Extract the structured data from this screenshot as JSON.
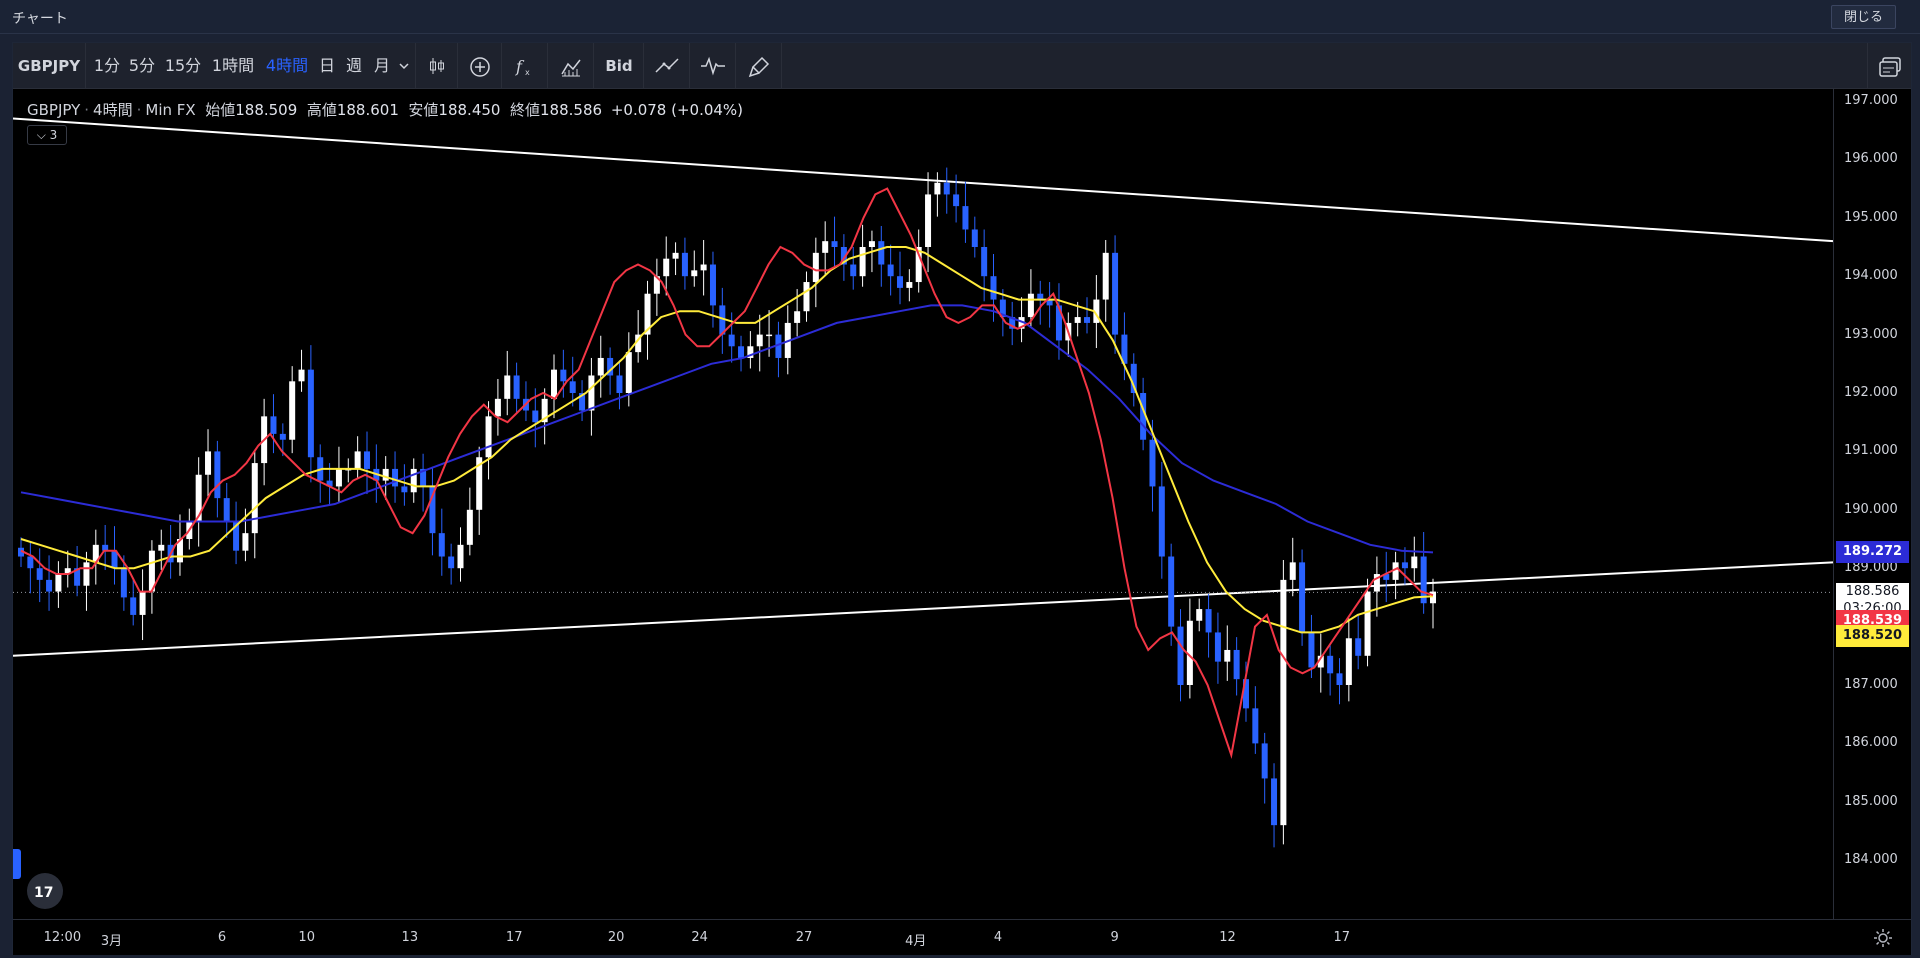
{
  "window": {
    "title": "チャート",
    "close_label": "閉じる"
  },
  "toolbar": {
    "symbol": "GBPJPY",
    "intervals": [
      "1分",
      "5分",
      "15分",
      "1時間",
      "4時間",
      "日",
      "週",
      "月"
    ],
    "active_interval": "4時間",
    "bid_label": "Bid",
    "icons": [
      "candle-style-icon",
      "add-compare-icon",
      "indicators-icon",
      "chart-type-icon",
      "line-tool-icon",
      "oscillator-icon",
      "brush-icon",
      "layout-icon"
    ]
  },
  "legend": {
    "symbol": "GBPJPY",
    "interval": "4時間",
    "source": "Min FX",
    "open_label": "始値",
    "open": "188.509",
    "high_label": "高値",
    "high": "188.601",
    "low_label": "安値",
    "low": "188.450",
    "close_label": "終値",
    "close": "188.586",
    "change": "+0.078 (+0.04%)",
    "collapsed_count": "3"
  },
  "price_axis": {
    "ticks": [
      "197.000",
      "196.000",
      "195.000",
      "194.000",
      "193.000",
      "192.000",
      "191.000",
      "190.000",
      "189.000",
      "188.000",
      "187.000",
      "186.000",
      "185.000",
      "184.000"
    ],
    "labels": {
      "ma_blue": "189.272",
      "last_price": "188.586",
      "countdown": "03:26:00",
      "ma_red": "188.539",
      "ma_yellow": "188.520"
    }
  },
  "time_axis": {
    "ticks": [
      "12:00",
      "3月",
      "6",
      "10",
      "13",
      "17",
      "20",
      "24",
      "27",
      "4月",
      "4",
      "9",
      "12",
      "17"
    ]
  },
  "colors": {
    "up": "#ffffff",
    "down": "#2962ff",
    "ma_fast": "#f23645",
    "ma_mid": "#ffeb3b",
    "ma_slow": "#2c2cd6",
    "trendline": "#ffffff",
    "accent": "#2962ff"
  },
  "chart_data": {
    "type": "candlestick",
    "symbol": "GBPJPY",
    "interval": "4時間",
    "ylim": [
      183.6,
      197.4
    ],
    "close": [
      189.2,
      189.0,
      188.8,
      188.6,
      188.9,
      189.0,
      188.7,
      189.1,
      189.4,
      189.3,
      189.0,
      188.5,
      188.2,
      188.6,
      189.3,
      189.4,
      189.1,
      189.5,
      189.8,
      190.6,
      191.0,
      190.2,
      189.8,
      189.3,
      189.6,
      190.8,
      191.6,
      191.3,
      191.2,
      192.2,
      192.4,
      190.9,
      190.5,
      190.4,
      190.7,
      190.7,
      191.0,
      190.7,
      190.5,
      190.7,
      190.4,
      190.3,
      190.7,
      190.4,
      189.6,
      189.2,
      189.0,
      189.4,
      190.0,
      190.9,
      191.6,
      191.9,
      192.3,
      191.9,
      191.7,
      191.5,
      191.9,
      192.4,
      192.2,
      192.0,
      191.7,
      192.3,
      192.6,
      192.3,
      192.0,
      192.7,
      193.0,
      193.7,
      194.0,
      194.3,
      194.4,
      194.0,
      194.1,
      194.2,
      193.5,
      193.0,
      192.8,
      192.6,
      192.8,
      193.0,
      193.0,
      192.6,
      193.2,
      193.4,
      193.9,
      194.4,
      194.6,
      194.5,
      194.2,
      194.0,
      194.5,
      194.6,
      194.2,
      194.0,
      193.8,
      193.9,
      194.5,
      195.4,
      195.6,
      195.4,
      195.2,
      194.8,
      194.5,
      194.0,
      193.6,
      193.3,
      193.1,
      193.3,
      193.7,
      193.6,
      193.5,
      192.9,
      193.2,
      193.3,
      193.2,
      193.6,
      194.4,
      193.0,
      192.5,
      192.0,
      191.2,
      190.4,
      189.2,
      188.0,
      187.0,
      188.1,
      188.3,
      187.9,
      187.4,
      187.6,
      187.1,
      186.6,
      186.0,
      185.4,
      184.6,
      188.8,
      189.1,
      187.9,
      187.3,
      187.5,
      187.2,
      187.0,
      187.8,
      187.5,
      188.6,
      188.9,
      188.8,
      189.1,
      189.0,
      189.2,
      188.4,
      188.6
    ],
    "ma_fast": [
      189.3,
      189.2,
      189.0,
      188.9,
      188.9,
      189.0,
      189.0,
      189.3,
      189.3,
      189.0,
      188.6,
      188.6,
      189.0,
      189.4,
      189.6,
      189.9,
      190.3,
      190.5,
      190.6,
      190.8,
      191.1,
      191.3,
      191.0,
      190.8,
      190.6,
      190.5,
      190.4,
      190.3,
      190.5,
      190.6,
      190.5,
      190.1,
      189.7,
      189.6,
      189.9,
      190.4,
      190.9,
      191.3,
      191.6,
      191.8,
      191.6,
      191.5,
      191.7,
      191.9,
      192.0,
      191.9,
      192.2,
      192.4,
      192.9,
      193.4,
      193.9,
      194.1,
      194.2,
      194.1,
      193.9,
      193.5,
      193.0,
      192.8,
      192.8,
      193.0,
      193.2,
      193.4,
      193.8,
      194.2,
      194.5,
      194.4,
      194.2,
      194.1,
      194.1,
      194.2,
      194.5,
      195.0,
      195.4,
      195.5,
      195.1,
      194.7,
      194.2,
      193.7,
      193.3,
      193.2,
      193.3,
      193.5,
      193.5,
      193.2,
      193.1,
      193.2,
      193.5,
      193.7,
      193.2,
      192.6,
      192.0,
      191.2,
      190.2,
      189.0,
      188.0,
      187.6,
      187.8,
      187.9,
      187.6,
      187.4,
      187.0,
      186.4,
      185.8,
      186.9,
      188.0,
      188.2,
      187.6,
      187.3,
      187.2,
      187.3,
      187.6,
      187.9,
      188.2,
      188.5,
      188.8,
      188.9,
      189.0,
      188.8,
      188.6,
      188.54
    ],
    "ma_mid": [
      189.5,
      189.4,
      189.3,
      189.2,
      189.1,
      189.0,
      189.0,
      189.1,
      189.2,
      189.2,
      189.3,
      189.6,
      189.9,
      190.2,
      190.4,
      190.6,
      190.7,
      190.7,
      190.7,
      190.6,
      190.5,
      190.4,
      190.4,
      190.5,
      190.7,
      190.9,
      191.2,
      191.4,
      191.6,
      191.8,
      192.0,
      192.3,
      192.6,
      193.0,
      193.3,
      193.4,
      193.4,
      193.3,
      193.2,
      193.2,
      193.4,
      193.6,
      193.8,
      194.1,
      194.3,
      194.4,
      194.5,
      194.5,
      194.4,
      194.2,
      194.0,
      193.8,
      193.7,
      193.6,
      193.6,
      193.6,
      193.5,
      193.4,
      192.9,
      192.2,
      191.4,
      190.6,
      189.8,
      189.1,
      188.6,
      188.3,
      188.1,
      188.0,
      187.9,
      187.9,
      188.0,
      188.2,
      188.3,
      188.4,
      188.5,
      188.52
    ],
    "ma_slow": [
      190.3,
      190.2,
      190.1,
      190.0,
      189.9,
      189.8,
      189.8,
      189.8,
      189.9,
      190.0,
      190.1,
      190.3,
      190.5,
      190.7,
      190.9,
      191.1,
      191.3,
      191.5,
      191.7,
      191.9,
      192.1,
      192.3,
      192.5,
      192.6,
      192.8,
      193.0,
      193.2,
      193.3,
      193.4,
      193.5,
      193.5,
      193.4,
      193.2,
      192.8,
      192.4,
      191.9,
      191.3,
      190.8,
      190.5,
      190.3,
      190.1,
      189.8,
      189.6,
      189.4,
      189.3,
      189.27
    ],
    "trendlines": [
      {
        "from": [
          "start",
          196.7
        ],
        "to": [
          "end",
          194.6
        ]
      },
      {
        "from": [
          "start",
          187.5
        ],
        "to": [
          "end",
          189.1
        ]
      }
    ],
    "last_price": 188.586
  }
}
